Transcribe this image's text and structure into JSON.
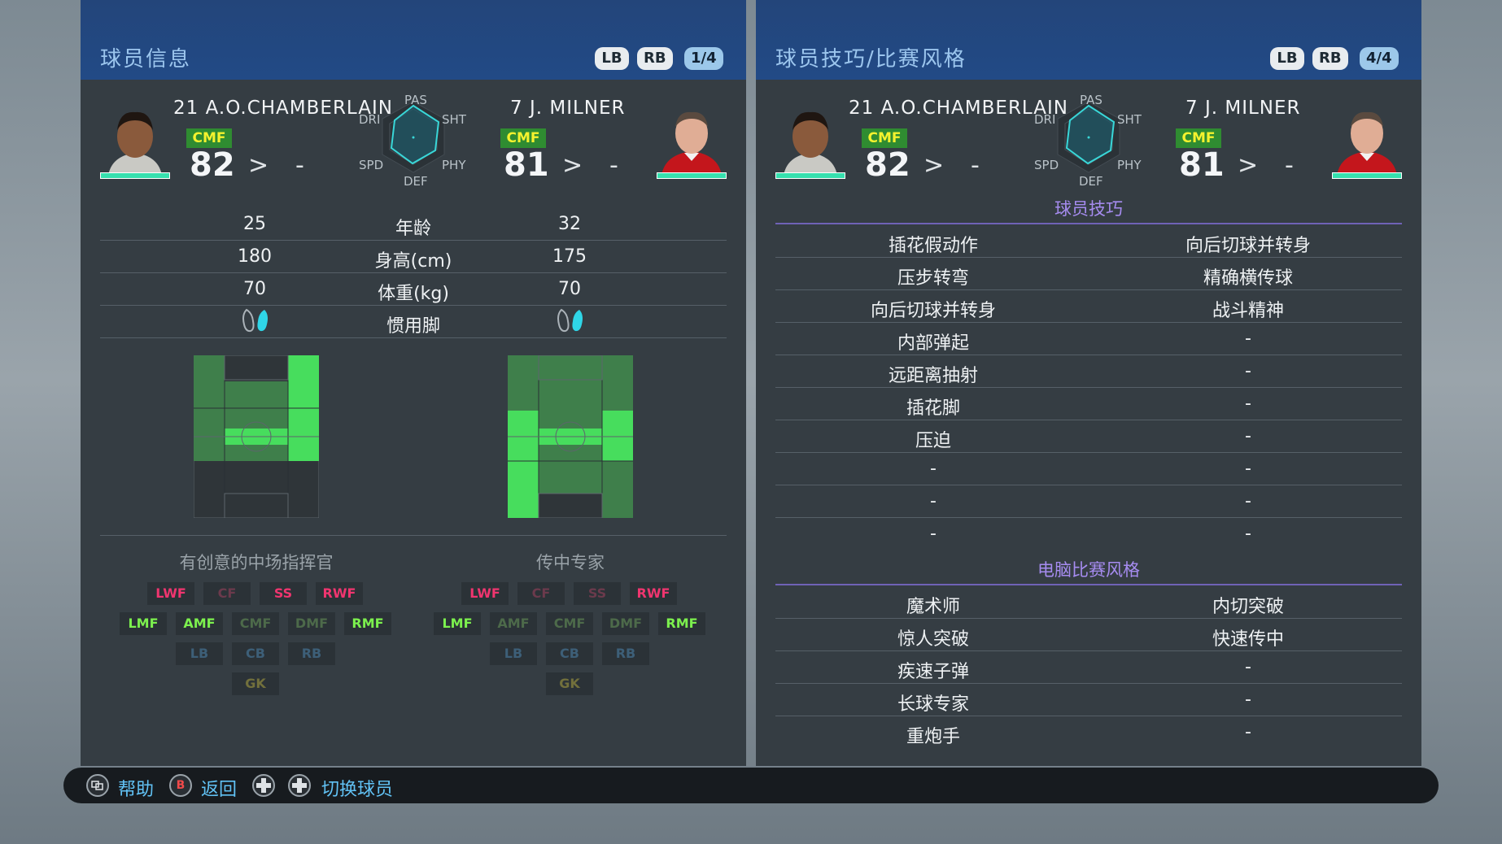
{
  "left_panel": {
    "title": "球员信息",
    "buttons": {
      "lb": "LB",
      "rb": "RB",
      "page": "1/4"
    },
    "p1": {
      "name": "21 A.O.CHAMBERLAIN",
      "pos": "CMF",
      "rating": "82",
      "arrow": ">",
      "dash": "-"
    },
    "p2": {
      "name": "7 J. MILNER",
      "pos": "CMF",
      "rating": "81",
      "arrow": ">",
      "dash": "-"
    },
    "radar_labels": {
      "pas": "PAS",
      "sht": "SHT",
      "phy": "PHY",
      "def": "DEF",
      "spd": "SPD",
      "dri": "DRI"
    },
    "stats": [
      {
        "label": "年龄",
        "p1": "25",
        "p2": "32"
      },
      {
        "label": "身高(cm)",
        "p1": "180",
        "p2": "175"
      },
      {
        "label": "体重(kg)",
        "p1": "70",
        "p2": "70"
      },
      {
        "label": "惯用脚",
        "p1": "",
        "p2": ""
      }
    ],
    "p1_style": "有创意的中场指挥官",
    "p2_style": "传中专家",
    "positions": {
      "lwf": "LWF",
      "cf": "CF",
      "ss": "SS",
      "rwf": "RWF",
      "lmf": "LMF",
      "amf": "AMF",
      "cmf": "CMF",
      "dmf": "DMF",
      "rmf": "RMF",
      "lb": "LB",
      "cb": "CB",
      "rb": "RB",
      "gk": "GK"
    }
  },
  "right_panel": {
    "title": "球员技巧/比赛风格",
    "buttons": {
      "lb": "LB",
      "rb": "RB",
      "page": "4/4"
    },
    "p1": {
      "name": "21 A.O.CHAMBERLAIN",
      "pos": "CMF",
      "rating": "82",
      "arrow": ">",
      "dash": "-"
    },
    "p2": {
      "name": "7 J. MILNER",
      "pos": "CMF",
      "rating": "81",
      "arrow": ">",
      "dash": "-"
    },
    "radar_labels": {
      "pas": "PAS",
      "sht": "SHT",
      "phy": "PHY",
      "def": "DEF",
      "spd": "SPD",
      "dri": "DRI"
    },
    "skills_header": "球员技巧",
    "skills": [
      {
        "p1": "插花假动作",
        "p2": "向后切球并转身"
      },
      {
        "p1": "压步转弯",
        "p2": "精确横传球"
      },
      {
        "p1": "向后切球并转身",
        "p2": "战斗精神"
      },
      {
        "p1": "内部弹起",
        "p2": "-"
      },
      {
        "p1": "远距离抽射",
        "p2": "-"
      },
      {
        "p1": "插花脚",
        "p2": "-"
      },
      {
        "p1": "压迫",
        "p2": "-"
      },
      {
        "p1": "-",
        "p2": "-"
      },
      {
        "p1": "-",
        "p2": "-"
      },
      {
        "p1": "-",
        "p2": "-"
      }
    ],
    "com_header": "电脑比赛风格",
    "com_styles": [
      {
        "p1": "魔术师",
        "p2": "内切突破"
      },
      {
        "p1": "惊人突破",
        "p2": "快速传中"
      },
      {
        "p1": "疾速子弹",
        "p2": "-"
      },
      {
        "p1": "长球专家",
        "p2": "-"
      },
      {
        "p1": "重炮手",
        "p2": "-"
      }
    ]
  },
  "footer": {
    "help_label": "帮助",
    "back_key": "B",
    "back_label": "返回",
    "switch_label": "切换球员"
  },
  "colors": {
    "header_blue": "#224a86",
    "panel_bg": "#353d43",
    "accent_cyan": "#36e0ae",
    "badge_green": "#2f8c31",
    "badge_yellow_text": "#f4f22e",
    "section_purple": "#a68cf0"
  }
}
